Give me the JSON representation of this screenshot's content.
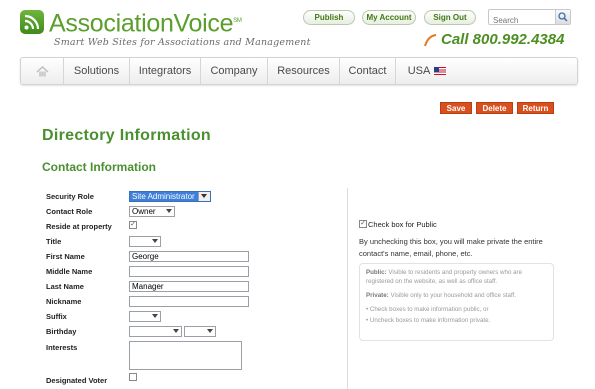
{
  "brand": {
    "name": "AssociationVoice",
    "sm_mark": "SM",
    "tagline": "Smart Web Sites for Associations and Management",
    "call": "Call 800.992.4384"
  },
  "top_buttons": {
    "publish": "Publish",
    "my_account": "My Account",
    "sign_out": "Sign Out"
  },
  "search": {
    "placeholder": "Search"
  },
  "nav": {
    "items": [
      "Solutions",
      "Integrators",
      "Company",
      "Resources",
      "Contact",
      "USA"
    ]
  },
  "actions": {
    "save": "Save",
    "delete": "Delete",
    "return": "Return"
  },
  "page_title": "Directory Information",
  "section_title": "Contact Information",
  "form": {
    "security_role": {
      "label": "Security Role",
      "value": "Site Administrator"
    },
    "contact_role": {
      "label": "Contact Role",
      "value": "Owner"
    },
    "reside": {
      "label": "Reside at property",
      "checked": true
    },
    "title": {
      "label": "Title",
      "value": ""
    },
    "first_name": {
      "label": "First Name",
      "value": "George"
    },
    "middle_name": {
      "label": "Middle Name",
      "value": ""
    },
    "last_name": {
      "label": "Last Name",
      "value": "Manager"
    },
    "nickname": {
      "label": "Nickname",
      "value": ""
    },
    "suffix": {
      "label": "Suffix",
      "value": ""
    },
    "birthday": {
      "label": "Birthday",
      "month": "",
      "day": ""
    },
    "interests": {
      "label": "Interests",
      "value": ""
    },
    "designated_voter": {
      "label": "Designated Voter",
      "checked": false
    }
  },
  "public_panel": {
    "checkbox_label": "Check box for Public",
    "checked": true,
    "description": "By unchecking this box, you will make private the entire contact's name, email, phone, etc.",
    "public_title": "Public:",
    "public_text": "Visible to residents and property owners who are registered on the website, as well as office staff.",
    "private_title": "Private:",
    "private_text": "Visible only to your household and office staff.",
    "bullet1": "Check boxes to make information public, or",
    "bullet2": "Uncheck boxes to make information private."
  },
  "colors": {
    "brand_green": "#5a9e2b",
    "action_orange": "#d9501f",
    "heading_green": "#4a9030",
    "select_highlight": "#3d7fd9"
  }
}
